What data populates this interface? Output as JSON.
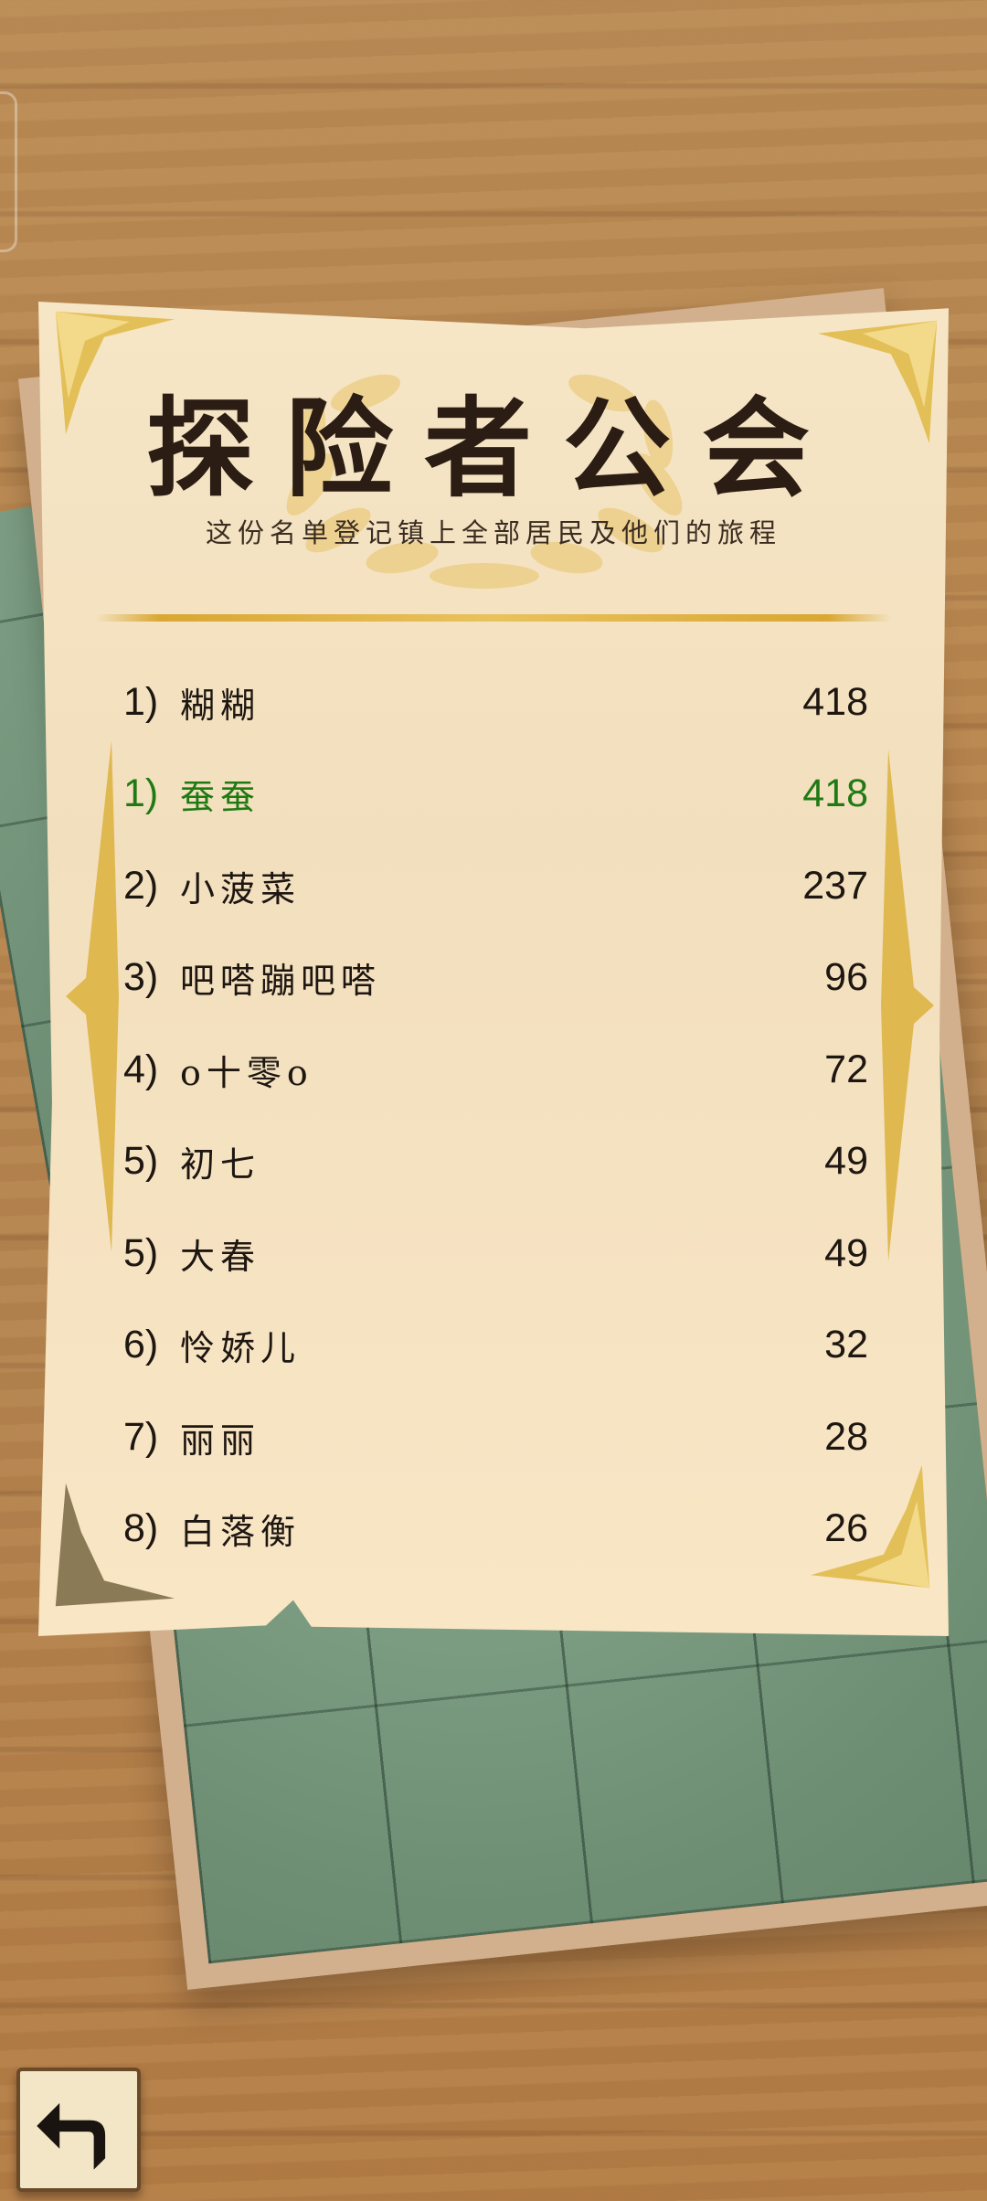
{
  "guild": {
    "title": "探险者公会",
    "subtitle": "这份名单登记镇上全部居民及他们的旅程"
  },
  "leaderboard": [
    {
      "rank": "1)",
      "name": "糊糊",
      "score": "418",
      "highlight": false
    },
    {
      "rank": "1)",
      "name": "蚕蚕",
      "score": "418",
      "highlight": true
    },
    {
      "rank": "2)",
      "name": "小菠菜",
      "score": "237",
      "highlight": false
    },
    {
      "rank": "3)",
      "name": "吧嗒蹦吧嗒",
      "score": "96",
      "highlight": false
    },
    {
      "rank": "4)",
      "name": "o十零o",
      "score": "72",
      "highlight": false
    },
    {
      "rank": "5)",
      "name": "初七",
      "score": "49",
      "highlight": false
    },
    {
      "rank": "5)",
      "name": "大春",
      "score": "49",
      "highlight": false
    },
    {
      "rank": "6)",
      "name": "怜娇儿",
      "score": "32",
      "highlight": false
    },
    {
      "rank": "7)",
      "name": "丽丽",
      "score": "28",
      "highlight": false
    },
    {
      "rank": "8)",
      "name": "白落衡",
      "score": "26",
      "highlight": false
    }
  ],
  "colors": {
    "highlight": "#1f7a14",
    "text": "#1d1611",
    "gold": "#d9a732"
  },
  "icons": {
    "back": "back-arrow-icon"
  }
}
